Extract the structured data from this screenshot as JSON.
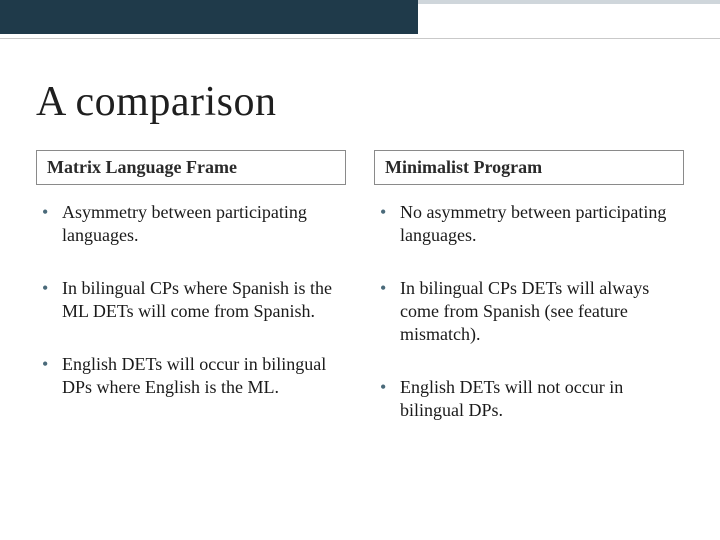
{
  "title": "A comparison",
  "columns": [
    {
      "header": "Matrix Language Frame",
      "points": [
        "Asymmetry between participating languages.",
        "In bilingual CPs where Spanish is the ML DETs will come from Spanish.",
        "English DETs will occur in bilingual DPs where English is the ML."
      ]
    },
    {
      "header": "Minimalist Program",
      "points": [
        "No asymmetry between participating languages.",
        "In bilingual CPs DETs will always come from Spanish (see feature mismatch).",
        "English DETs will not occur in bilingual DPs."
      ]
    }
  ]
}
